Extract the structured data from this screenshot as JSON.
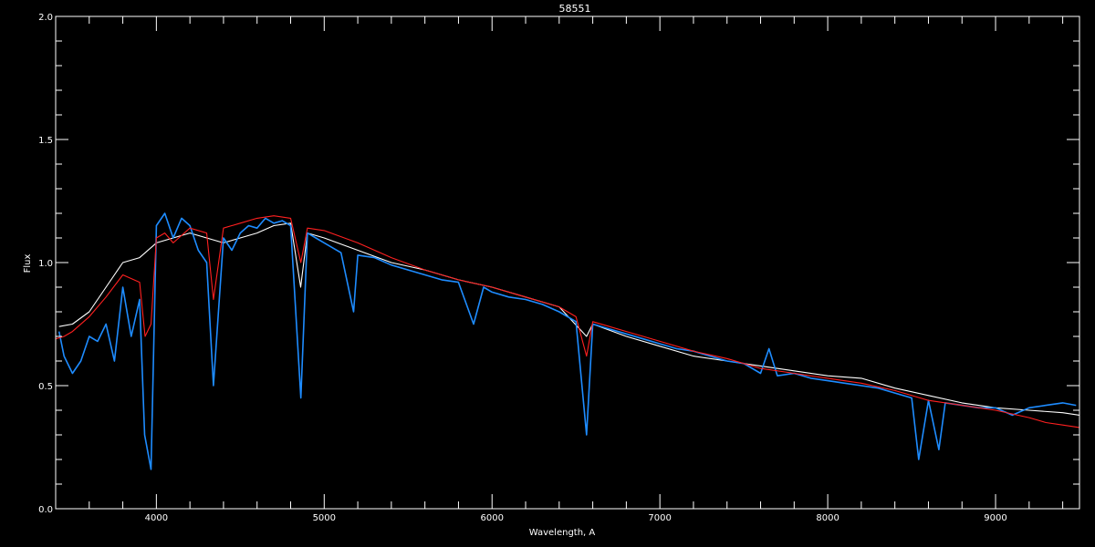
{
  "chart_data": {
    "type": "line",
    "title": "58551",
    "xlabel": "Wavelength, A",
    "ylabel": "Flux",
    "xlim": [
      3400,
      9500
    ],
    "ylim": [
      0,
      2.0
    ],
    "xticks": [
      4000,
      5000,
      6000,
      7000,
      8000,
      9000
    ],
    "xtick_labels": [
      "4000",
      "5000",
      "6000",
      "7000",
      "8000",
      "9000"
    ],
    "yticks": [
      0,
      0.5,
      1.0,
      1.5,
      2.0
    ],
    "ytick_labels": [
      "0.0",
      "0.5",
      "1.0",
      "1.5",
      "2.0"
    ],
    "grid": false,
    "colors": {
      "background": "#000000",
      "axes": "#ffffff",
      "observed": "#ffffff",
      "spectrum": "#1e8cff",
      "model": "#ff2020"
    },
    "series": [
      {
        "color": "#ffffff",
        "x": [
          3420,
          3500,
          3600,
          3700,
          3800,
          3900,
          4000,
          4100,
          4200,
          4300,
          4400,
          4500,
          4600,
          4700,
          4800,
          4860,
          4900,
          5000,
          5200,
          5400,
          5600,
          5800,
          6000,
          6200,
          6400,
          6563,
          6600,
          6800,
          7000,
          7200,
          7400,
          7600,
          7800,
          8000,
          8200,
          8400,
          8600,
          8800,
          9000,
          9200,
          9400,
          9500
        ],
        "y": [
          0.74,
          0.75,
          0.8,
          0.9,
          1.0,
          1.02,
          1.08,
          1.1,
          1.12,
          1.1,
          1.08,
          1.1,
          1.12,
          1.15,
          1.16,
          0.9,
          1.12,
          1.1,
          1.05,
          1.0,
          0.97,
          0.93,
          0.9,
          0.86,
          0.82,
          0.7,
          0.75,
          0.7,
          0.66,
          0.62,
          0.6,
          0.58,
          0.56,
          0.54,
          0.53,
          0.49,
          0.46,
          0.43,
          0.41,
          0.4,
          0.39,
          0.38
        ]
      },
      {
        "color": "#1e8cff",
        "x": [
          3420,
          3450,
          3500,
          3550,
          3600,
          3650,
          3700,
          3750,
          3800,
          3850,
          3900,
          3930,
          3968,
          4000,
          4050,
          4100,
          4150,
          4200,
          4250,
          4300,
          4340,
          4400,
          4450,
          4500,
          4550,
          4600,
          4650,
          4700,
          4750,
          4800,
          4861,
          4900,
          4950,
          5000,
          5100,
          5175,
          5200,
          5300,
          5400,
          5500,
          5600,
          5700,
          5800,
          5890,
          5950,
          6000,
          6100,
          6200,
          6300,
          6400,
          6500,
          6563,
          6600,
          6700,
          6800,
          6900,
          7000,
          7100,
          7200,
          7300,
          7400,
          7500,
          7600,
          7650,
          7700,
          7800,
          7900,
          8000,
          8100,
          8200,
          8300,
          8400,
          8500,
          8542,
          8600,
          8662,
          8700,
          8800,
          8900,
          9000,
          9100,
          9200,
          9300,
          9400,
          9480
        ],
        "y": [
          0.72,
          0.62,
          0.55,
          0.6,
          0.7,
          0.68,
          0.75,
          0.6,
          0.9,
          0.7,
          0.85,
          0.3,
          0.16,
          1.15,
          1.2,
          1.1,
          1.18,
          1.15,
          1.05,
          1.0,
          0.5,
          1.1,
          1.05,
          1.12,
          1.15,
          1.14,
          1.18,
          1.16,
          1.17,
          1.15,
          0.45,
          1.12,
          1.1,
          1.08,
          1.04,
          0.8,
          1.03,
          1.02,
          0.99,
          0.97,
          0.95,
          0.93,
          0.92,
          0.75,
          0.9,
          0.88,
          0.86,
          0.85,
          0.83,
          0.8,
          0.76,
          0.3,
          0.75,
          0.73,
          0.71,
          0.69,
          0.67,
          0.65,
          0.64,
          0.62,
          0.6,
          0.59,
          0.55,
          0.65,
          0.54,
          0.55,
          0.53,
          0.52,
          0.51,
          0.5,
          0.49,
          0.47,
          0.45,
          0.2,
          0.44,
          0.24,
          0.43,
          0.42,
          0.41,
          0.41,
          0.38,
          0.41,
          0.42,
          0.43,
          0.42
        ]
      },
      {
        "color": "#ff2020",
        "x": [
          3400,
          3450,
          3500,
          3600,
          3700,
          3800,
          3900,
          3933,
          3968,
          4000,
          4050,
          4100,
          4200,
          4300,
          4340,
          4400,
          4500,
          4600,
          4700,
          4800,
          4861,
          4900,
          5000,
          5200,
          5400,
          5600,
          5800,
          6000,
          6200,
          6400,
          6500,
          6563,
          6600,
          6800,
          7000,
          7200,
          7400,
          7600,
          7800,
          8000,
          8200,
          8400,
          8600,
          8800,
          9000,
          9200,
          9300,
          9400,
          9500
        ],
        "y": [
          0.69,
          0.7,
          0.72,
          0.78,
          0.86,
          0.95,
          0.92,
          0.7,
          0.75,
          1.1,
          1.12,
          1.08,
          1.14,
          1.12,
          0.85,
          1.14,
          1.16,
          1.18,
          1.19,
          1.18,
          1.0,
          1.14,
          1.13,
          1.08,
          1.02,
          0.97,
          0.93,
          0.9,
          0.86,
          0.82,
          0.78,
          0.62,
          0.76,
          0.72,
          0.68,
          0.64,
          0.61,
          0.57,
          0.55,
          0.53,
          0.51,
          0.48,
          0.44,
          0.42,
          0.4,
          0.37,
          0.35,
          0.34,
          0.33
        ]
      }
    ]
  }
}
